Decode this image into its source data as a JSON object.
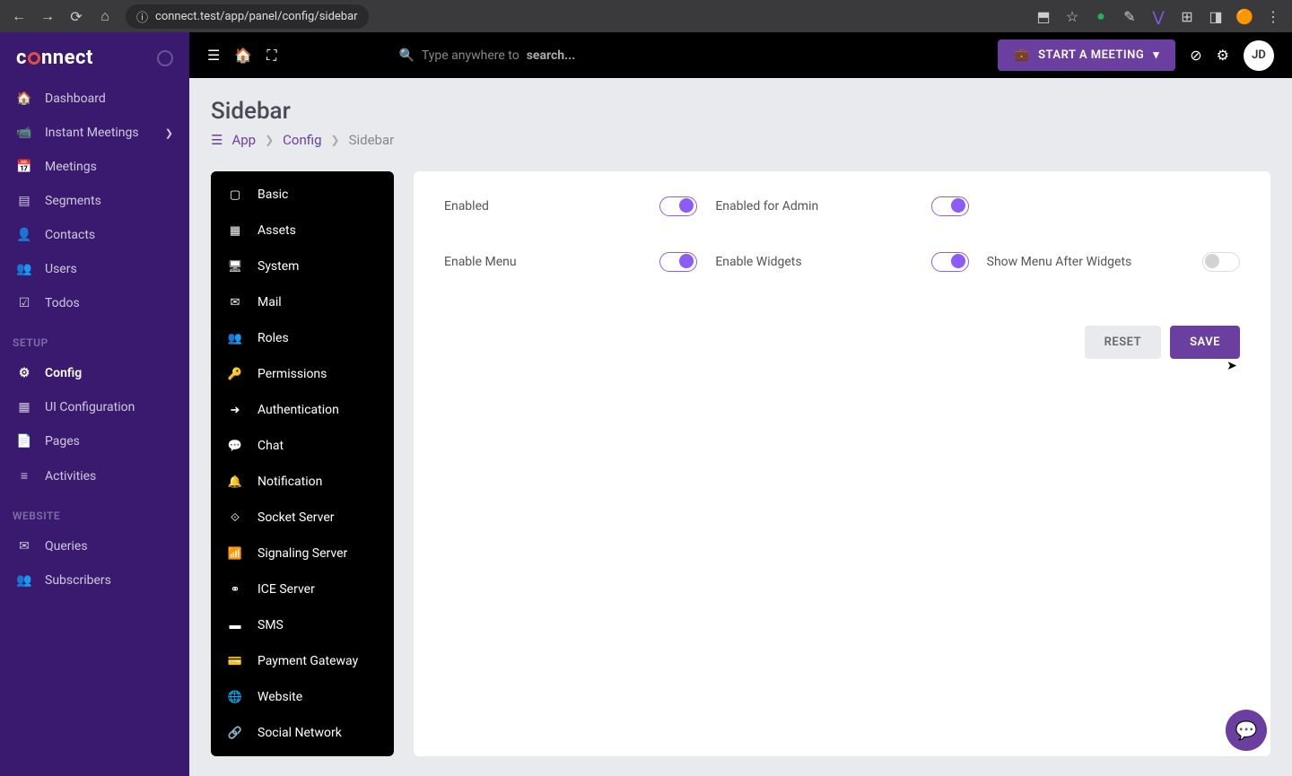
{
  "browser": {
    "url": "connect.test/app/panel/config/sidebar"
  },
  "logo": {
    "text_pre": "c",
    "text_post": "nnect"
  },
  "sidebar": {
    "items": [
      {
        "icon": "🏠",
        "label": "Dashboard"
      },
      {
        "icon": "📹",
        "label": "Instant Meetings",
        "expandable": true
      },
      {
        "icon": "📅",
        "label": "Meetings"
      },
      {
        "icon": "▤",
        "label": "Segments"
      },
      {
        "icon": "👤",
        "label": "Contacts"
      },
      {
        "icon": "👥",
        "label": "Users"
      },
      {
        "icon": "☑",
        "label": "Todos"
      }
    ],
    "setup_heading": "SETUP",
    "setup_items": [
      {
        "icon": "⚙",
        "label": "Config",
        "active": true
      },
      {
        "icon": "▦",
        "label": "UI Configuration"
      },
      {
        "icon": "📄",
        "label": "Pages"
      },
      {
        "icon": "≡",
        "label": "Activities"
      }
    ],
    "website_heading": "WEBSITE",
    "website_items": [
      {
        "icon": "✉",
        "label": "Queries"
      },
      {
        "icon": "👥",
        "label": "Subscribers"
      }
    ]
  },
  "topbar": {
    "search_placeholder_pre": "Type anywhere to ",
    "search_placeholder_strong": "search...",
    "start_meeting": "START A MEETING",
    "avatar": "JD"
  },
  "page": {
    "title": "Sidebar",
    "breadcrumb": {
      "app": "App",
      "config": "Config",
      "current": "Sidebar"
    }
  },
  "config_nav": [
    {
      "icon": "▢",
      "label": "Basic"
    },
    {
      "icon": "▦",
      "label": "Assets"
    },
    {
      "icon": "🖥",
      "label": "System"
    },
    {
      "icon": "✉",
      "label": "Mail"
    },
    {
      "icon": "👥",
      "label": "Roles"
    },
    {
      "icon": "🔑",
      "label": "Permissions"
    },
    {
      "icon": "➜",
      "label": "Authentication"
    },
    {
      "icon": "💬",
      "label": "Chat"
    },
    {
      "icon": "🔔",
      "label": "Notification"
    },
    {
      "icon": "⟐",
      "label": "Socket Server"
    },
    {
      "icon": "📶",
      "label": "Signaling Server"
    },
    {
      "icon": "⚭",
      "label": "ICE Server"
    },
    {
      "icon": "▬",
      "label": "SMS"
    },
    {
      "icon": "💳",
      "label": "Payment Gateway"
    },
    {
      "icon": "🌐",
      "label": "Website"
    },
    {
      "icon": "🔗",
      "label": "Social Network"
    }
  ],
  "toggles": {
    "enabled": {
      "label": "Enabled",
      "on": true
    },
    "enabled_admin": {
      "label": "Enabled for Admin",
      "on": true
    },
    "enable_menu": {
      "label": "Enable Menu",
      "on": true
    },
    "enable_widgets": {
      "label": "Enable Widgets",
      "on": true
    },
    "show_after": {
      "label": "Show Menu After Widgets",
      "on": false
    }
  },
  "actions": {
    "reset": "RESET",
    "save": "SAVE"
  }
}
